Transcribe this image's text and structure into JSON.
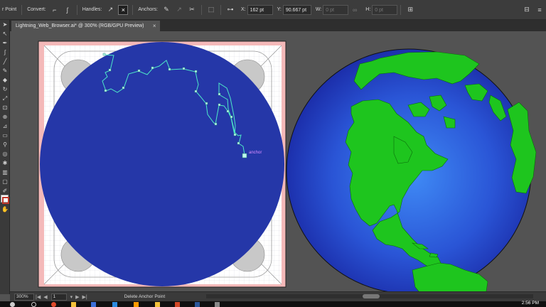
{
  "control_bar": {
    "tool_name": "r Point",
    "convert_label": "Convert:",
    "handles_label": "Handles:",
    "anchors_label": "Anchors:",
    "x_label": "X:",
    "x_value": "162 pt",
    "y_label": "Y:",
    "y_value": "90.667 pt",
    "w_label": "W:",
    "w_value": "0 pt",
    "h_label": "H:",
    "h_value": "0 pt"
  },
  "document": {
    "tab_title": "Lightning_Web_Browser.ai* @ 300% (RGB/GPU Preview)",
    "tab_close": "×",
    "anchor_tooltip": "anchor"
  },
  "status_bar": {
    "zoom": "300%",
    "page": "1",
    "status_text": "Delete Anchor Point"
  },
  "taskbar": {
    "clock": "2:56 PM"
  },
  "colors": {
    "ocean_left": "#2537a8",
    "ocean_right_center": "#3a7ff0",
    "ocean_right_edge": "#1a2aa6",
    "land": "#1ec51e",
    "path_selection": "#4de8c8",
    "artboard_margin": "#f4b9b9"
  },
  "icons": {
    "convert_corner": "convert-corner-icon",
    "convert_smooth": "convert-smooth-icon",
    "handles_show": "show-handles-icon",
    "handles_hide": "hide-handles-icon",
    "anchor_remove": "remove-anchor-icon",
    "anchor_connect": "connect-anchor-icon",
    "anchor_cut": "cut-path-icon",
    "isolate": "isolate-icon",
    "align": "align-icon",
    "transform": "transform-icon",
    "link": "link-proportions-icon"
  }
}
